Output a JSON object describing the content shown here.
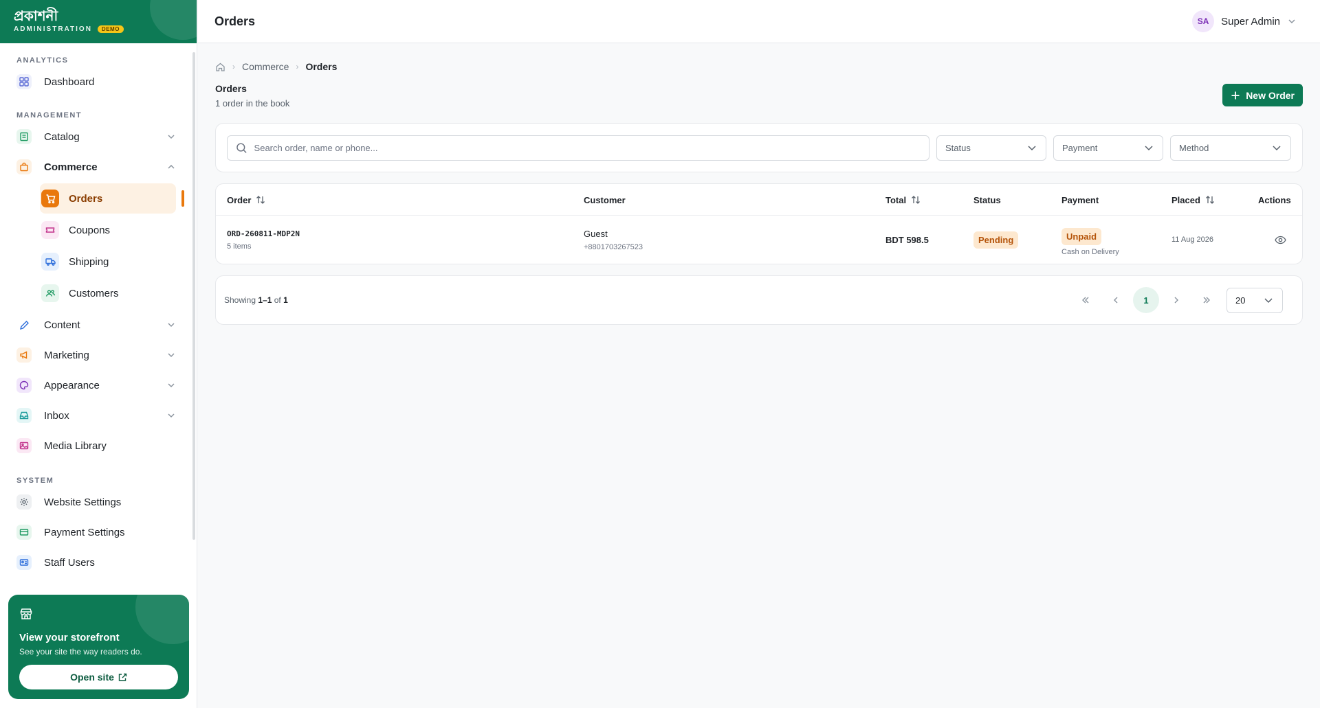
{
  "brand": {
    "name": "প্রকাশনী",
    "subtitle": "ADMINISTRATION",
    "badge": "DEMO"
  },
  "sidebar": {
    "sections": {
      "analytics": "ANALYTICS",
      "management": "MANAGEMENT",
      "system": "SYSTEM"
    },
    "items": {
      "dashboard": "Dashboard",
      "catalog": "Catalog",
      "commerce": "Commerce",
      "orders": "Orders",
      "coupons": "Coupons",
      "shipping": "Shipping",
      "customers": "Customers",
      "content": "Content",
      "marketing": "Marketing",
      "appearance": "Appearance",
      "inbox": "Inbox",
      "media_library": "Media Library",
      "website_settings": "Website Settings",
      "payment_settings": "Payment Settings",
      "staff_users": "Staff Users"
    },
    "storefront": {
      "title": "View your storefront",
      "description": "See your site the way readers do.",
      "button": "Open site"
    }
  },
  "topbar": {
    "title": "Orders",
    "user_initials": "SA",
    "user_name": "Super Admin"
  },
  "breadcrumb": {
    "parent": "Commerce",
    "current": "Orders"
  },
  "page": {
    "heading": "Orders",
    "subheading": "1 order in the book",
    "new_button": "New Order"
  },
  "filters": {
    "search_placeholder": "Search order, name or phone...",
    "status": "Status",
    "payment": "Payment",
    "method": "Method"
  },
  "table": {
    "headers": {
      "order": "Order",
      "customer": "Customer",
      "total": "Total",
      "status": "Status",
      "payment": "Payment",
      "placed": "Placed",
      "actions": "Actions"
    },
    "rows": [
      {
        "order_id": "ORD-260811-MDP2N",
        "items": "5 items",
        "customer_name": "Guest",
        "customer_phone": "+8801703267523",
        "total": "BDT 598.5",
        "status": "Pending",
        "payment_status": "Unpaid",
        "payment_method": "Cash on Delivery",
        "placed": "11 Aug 2026"
      }
    ]
  },
  "pagination": {
    "showing_prefix": "Showing",
    "range": "1–1",
    "of": "of",
    "total": "1",
    "current_page": "1",
    "per_page": "20"
  },
  "colors": {
    "brand_green": "#0d7a55",
    "accent_orange": "#e9780c",
    "pending_bg": "#fde8cf",
    "pending_text": "#b45309"
  }
}
